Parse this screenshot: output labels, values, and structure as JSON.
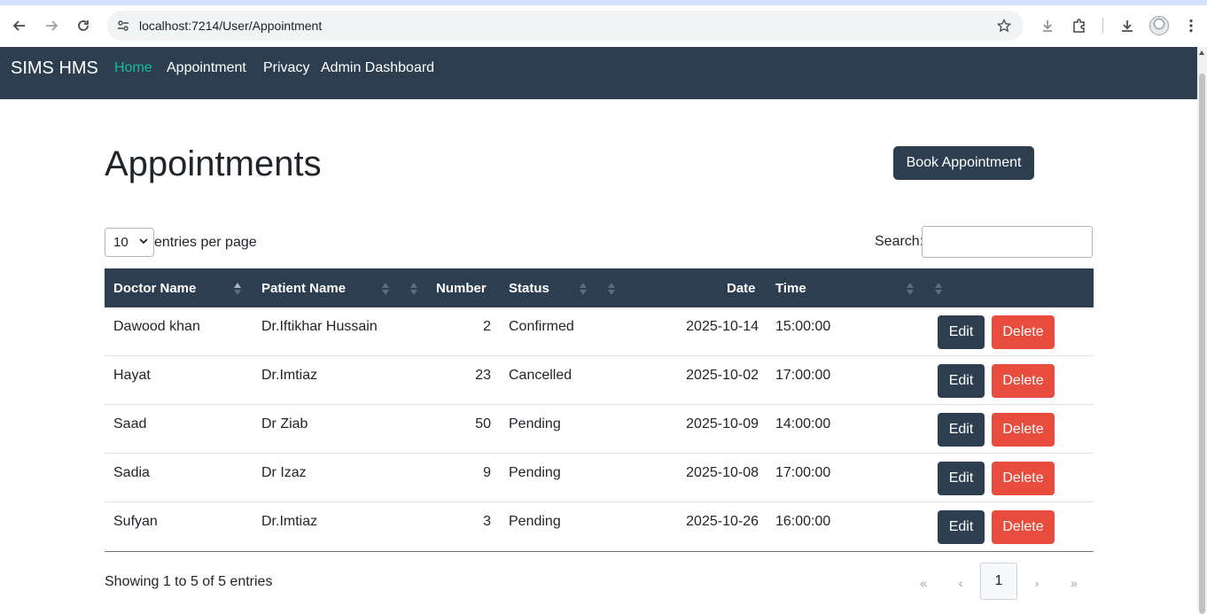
{
  "browser": {
    "url": "localhost:7214/User/Appointment"
  },
  "navbar": {
    "brand": "SIMS HMS",
    "links": [
      {
        "label": "Home",
        "active": true
      },
      {
        "label": "Appointment",
        "active": false
      },
      {
        "label": "Privacy",
        "active": false
      },
      {
        "label": "Admin Dashboard",
        "active": false
      }
    ]
  },
  "page": {
    "title": "Appointments",
    "book_button": "Book Appointment"
  },
  "table_controls": {
    "entries_value": "10",
    "entries_label": "entries per page",
    "search_label": "Search:",
    "search_value": ""
  },
  "table": {
    "headers": [
      "Doctor Name",
      "Patient Name",
      "Number",
      "Status",
      "Date",
      "Time"
    ],
    "rows": [
      {
        "doctor": "Dawood khan",
        "patient": "Dr.Iftikhar Hussain",
        "number": "2",
        "status": "Confirmed",
        "date": "2025-10-14",
        "time": "15:00:00"
      },
      {
        "doctor": "Hayat",
        "patient": "Dr.Imtiaz",
        "number": "23",
        "status": "Cancelled",
        "date": "2025-10-02",
        "time": "17:00:00"
      },
      {
        "doctor": "Saad",
        "patient": "Dr Ziab",
        "number": "50",
        "status": "Pending",
        "date": "2025-10-09",
        "time": "14:00:00"
      },
      {
        "doctor": "Sadia",
        "patient": "Dr Izaz",
        "number": "9",
        "status": "Pending",
        "date": "2025-10-08",
        "time": "17:00:00"
      },
      {
        "doctor": "Sufyan",
        "patient": "Dr.Imtiaz",
        "number": "3",
        "status": "Pending",
        "date": "2025-10-26",
        "time": "16:00:00"
      }
    ],
    "edit_label": "Edit",
    "delete_label": "Delete"
  },
  "footer": {
    "showing": "Showing 1 to 5 of 5 entries",
    "pager": {
      "first": "«",
      "prev": "‹",
      "current": "1",
      "next": "›",
      "last": "»"
    }
  },
  "colors": {
    "navbar": "#2c3e50",
    "active_link": "#18bc9c",
    "danger": "#e74c3c"
  }
}
